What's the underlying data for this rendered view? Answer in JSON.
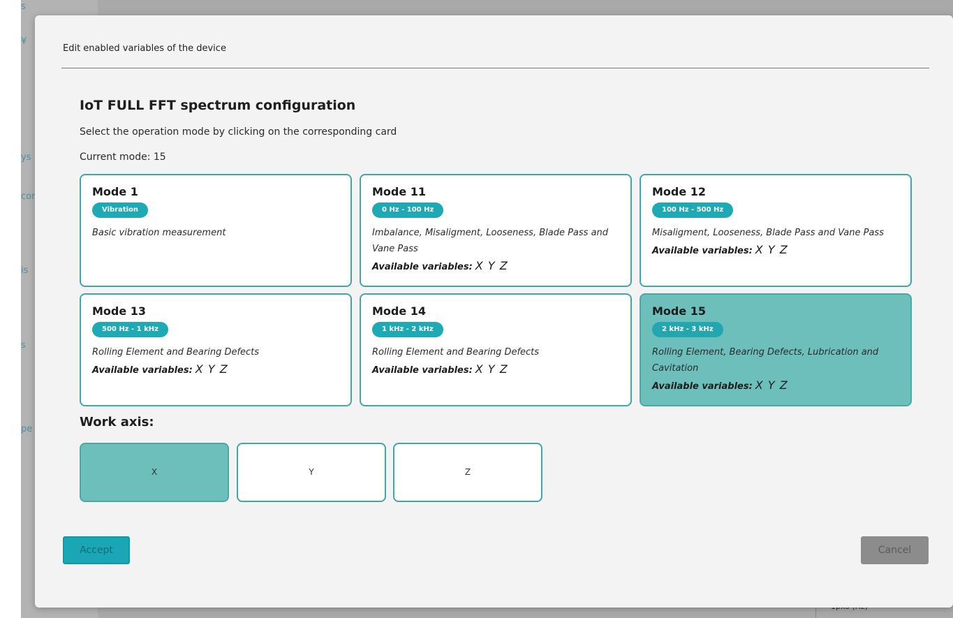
{
  "background": {
    "side_fragments": [
      "s",
      "¥",
      "ys",
      "cor",
      "is",
      "s",
      "pe"
    ],
    "bottom_right_text": "1pxo (Hz)"
  },
  "modal": {
    "title": "Edit enabled variables of the device",
    "section_title": "IoT FULL FFT spectrum configuration",
    "instruction": "Select the operation mode by clicking on the corresponding card",
    "current_mode": "Current mode: 15",
    "modes": [
      {
        "title": "Mode 1",
        "badge": "Vibration",
        "desc": "Basic vibration measurement",
        "vars_label": "",
        "vars_axes": "",
        "selected": false
      },
      {
        "title": "Mode 11",
        "badge": "0 Hz - 100 Hz",
        "desc": "Imbalance, Misaligment, Looseness, Blade Pass and Vane Pass",
        "vars_label": "Available variables:",
        "vars_axes": "X Y Z",
        "selected": false
      },
      {
        "title": "Mode 12",
        "badge": "100 Hz - 500 Hz",
        "desc": "Misaligment, Looseness, Blade Pass and Vane Pass",
        "vars_label": "Available variables:",
        "vars_axes": "X Y Z",
        "selected": false
      },
      {
        "title": "Mode 13",
        "badge": "500 Hz - 1 kHz",
        "desc": "Rolling Element and Bearing Defects",
        "vars_label": "Available variables:",
        "vars_axes": "X Y Z",
        "selected": false
      },
      {
        "title": "Mode 14",
        "badge": "1 kHz - 2 kHz",
        "desc": "Rolling Element and Bearing Defects",
        "vars_label": "Available variables:",
        "vars_axes": "X Y Z",
        "selected": false
      },
      {
        "title": "Mode 15",
        "badge": "2 kHz - 3 kHz",
        "desc": "Rolling Element, Bearing Defects, Lubrication and Cavitation",
        "vars_label": "Available variables:",
        "vars_axes": "X Y Z",
        "selected": true
      }
    ],
    "work_axis_label": "Work axis:",
    "axes": [
      {
        "label": "X",
        "selected": true
      },
      {
        "label": "Y",
        "selected": false
      },
      {
        "label": "Z",
        "selected": false
      }
    ],
    "accept_label": "Accept",
    "cancel_label": "Cancel"
  },
  "colors": {
    "accent": "#1eaab5",
    "card_border": "#3fa6aa",
    "selected_fill": "#6cbfba",
    "cancel_fill": "#8c8c8c"
  }
}
